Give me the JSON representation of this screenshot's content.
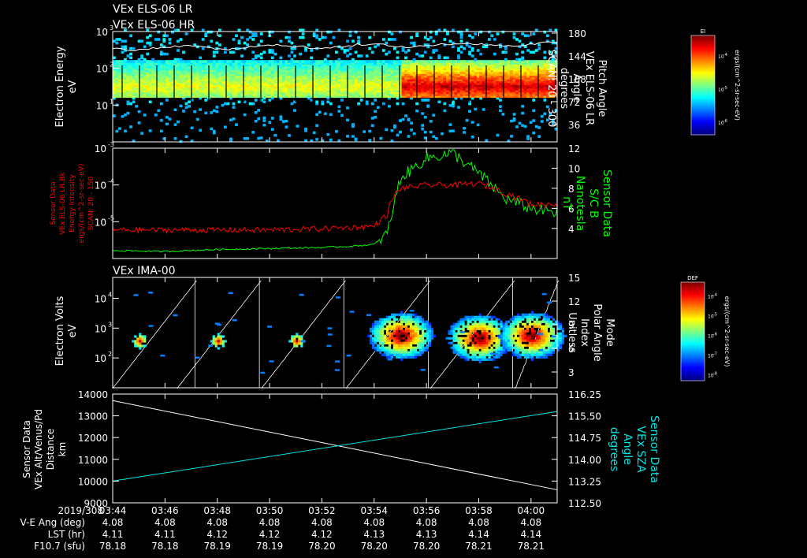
{
  "header": {
    "title_line1": "VEx ELS-06 LR",
    "title_line2": "VEx ELS-06 HR"
  },
  "colors": {
    "background": "#000000",
    "axes": "#ffffff",
    "b_field": "#00ff00",
    "energy_intensity": "#ff0000",
    "sza": "#00e5e5",
    "altitude": "#ffffff"
  },
  "chart_data": [
    {
      "type": "heatmap",
      "panel": "ELS spectrogram",
      "ylabel_left": [
        "Electron Energy",
        "eV"
      ],
      "ylim_left": [
        1,
        1000
      ],
      "log_left": true,
      "yticks_left": [
        "10",
        "10",
        "10"
      ],
      "yticks_left_exp": [
        "0",
        "1",
        "2",
        "3"
      ],
      "ylabel_right": [
        "Pitch Angle",
        "VEx ELS-06 LR",
        "Angle",
        "degrees",
        "SCAN: 20 - 300"
      ],
      "yticks_right": [
        "180",
        "144",
        "108",
        "72",
        "36"
      ],
      "overlay": "pitch angle (white line)",
      "colorbar": {
        "label": "EI",
        "units": "ergs/(cm^2-sr-sec-eV)",
        "tick_labels": [
          "10",
          "10",
          "10"
        ],
        "tick_exps": [
          "-4",
          "-5",
          "-6"
        ]
      },
      "features": {
        "band_low_ev": 15,
        "band_high_ev": 150,
        "enhancement_start": "03:55",
        "enhancement_end": "04:01"
      }
    },
    {
      "type": "line",
      "panel": "Energy intensity and B field",
      "ylabel_left": [
        "Sensor Data",
        "VEx ELS-06 LR Bk",
        "Energy Intensity",
        "ergs/(cm^2-sr-sec-eV)",
        "SCAN: 20 - 150"
      ],
      "ylim_left": [
        1e-06,
        0.001
      ],
      "log_left": true,
      "ylabel_right": [
        "Sensor Data",
        "S/C B",
        "Nanotesla",
        "nT"
      ],
      "ylim_right": [
        1,
        12
      ],
      "yticks_right": [
        "12",
        "10",
        "8",
        "6",
        "4"
      ],
      "series": [
        {
          "name": "VEx ELS-06 LR Bk",
          "axis": "left",
          "x": [
            "03:44",
            "03:46",
            "03:48",
            "03:50",
            "03:52",
            "03:53",
            "03:54",
            "03:54:30",
            "03:55",
            "03:56",
            "03:57",
            "03:58",
            "03:59",
            "04:00",
            "04:01"
          ],
          "values": [
            6e-06,
            6e-06,
            6e-06,
            6e-06,
            6.5e-06,
            7e-06,
            7.5e-06,
            1.5e-05,
            8e-05,
            0.0001,
            0.0001,
            0.00011,
            6e-05,
            3e-05,
            3e-05
          ]
        },
        {
          "name": "S/C B",
          "axis": "right",
          "x": [
            "03:44",
            "03:46",
            "03:48",
            "03:50",
            "03:52",
            "03:53",
            "03:54",
            "03:54:30",
            "03:55",
            "03:56",
            "03:57",
            "03:58",
            "03:59",
            "04:00",
            "04:01"
          ],
          "values": [
            1.8,
            1.7,
            1.9,
            2.0,
            2.1,
            2.2,
            2.4,
            3.5,
            9.0,
            11.0,
            11.5,
            9.5,
            7.0,
            6.0,
            5.5
          ]
        }
      ]
    },
    {
      "type": "heatmap",
      "panel": "IMA spectrogram",
      "title": "VEx IMA-00",
      "ylabel_left": [
        "Electron Volts",
        "eV"
      ],
      "ylim_left": [
        10,
        50000
      ],
      "log_left": true,
      "yticks_left": [
        "10",
        "10",
        "10"
      ],
      "yticks_left_exp": [
        "2",
        "3",
        "4"
      ],
      "ylabel_right": [
        "Mode",
        "Polar Angle",
        "Index",
        "Unitless"
      ],
      "ylim_right": [
        1,
        15
      ],
      "yticks_right": [
        "15",
        "12",
        "9",
        "6",
        "3"
      ],
      "colorbar": {
        "label": "DEF",
        "units": "ergs/(cm^2-sr-sec-eV)",
        "tick_labels": [
          "10",
          "10",
          "10",
          "10",
          "10"
        ],
        "tick_exps": [
          "-4",
          "-5",
          "-6",
          "-7",
          "-8"
        ]
      },
      "ion_blobs": [
        {
          "time": "03:45",
          "energy_ev": 400
        },
        {
          "time": "03:48",
          "energy_ev": 400
        },
        {
          "time": "03:51",
          "energy_ev": 400
        },
        {
          "time": "03:55",
          "energy_ev": 600
        },
        {
          "time": "03:58",
          "energy_ev": 500
        },
        {
          "time": "04:00",
          "energy_ev": 600
        }
      ]
    },
    {
      "type": "line",
      "panel": "Altitude and SZA",
      "ylabel_left": [
        "Sensor Data",
        "VEx Alt/Venus/Pd",
        "Distance",
        "km"
      ],
      "ylim_left": [
        9000,
        14000
      ],
      "yticks_left": [
        "14000",
        "13000",
        "12000",
        "11000",
        "10000",
        "9000"
      ],
      "ylabel_right": [
        "Sensor Data",
        "VEx SZA",
        "Angle",
        "degrees"
      ],
      "ylim_right": [
        112.5,
        116.25
      ],
      "yticks_right": [
        "116.25",
        "115.50",
        "114.75",
        "114.00",
        "113.25",
        "112.50"
      ],
      "series": [
        {
          "name": "VEx Alt/Venus/Pd",
          "axis": "left",
          "x": [
            "03:44",
            "04:01"
          ],
          "values": [
            13700,
            9600
          ]
        },
        {
          "name": "VEx SZA",
          "axis": "right",
          "x": [
            "03:44",
            "04:01"
          ],
          "values": [
            113.25,
            115.65
          ]
        }
      ]
    }
  ],
  "time_axis": {
    "xlim": [
      "03:44",
      "04:01"
    ],
    "ticks": [
      "03:44",
      "03:46",
      "03:48",
      "03:50",
      "03:52",
      "03:54",
      "03:56",
      "03:58",
      "04:00"
    ],
    "date_label": "2019/308"
  },
  "ephemeris": {
    "rows": [
      {
        "label": "V-E Ang (deg)",
        "values": [
          "4.08",
          "4.08",
          "4.08",
          "4.08",
          "4.08",
          "4.08",
          "4.08",
          "4.08",
          "4.08"
        ]
      },
      {
        "label": "LST (hr)",
        "values": [
          "4.11",
          "4.11",
          "4.12",
          "4.12",
          "4.12",
          "4.13",
          "4.13",
          "4.14",
          "4.14"
        ]
      },
      {
        "label": "F10.7 (sfu)",
        "values": [
          "78.18",
          "78.18",
          "78.19",
          "78.19",
          "78.20",
          "78.20",
          "78.20",
          "78.21",
          "78.21"
        ]
      }
    ]
  }
}
